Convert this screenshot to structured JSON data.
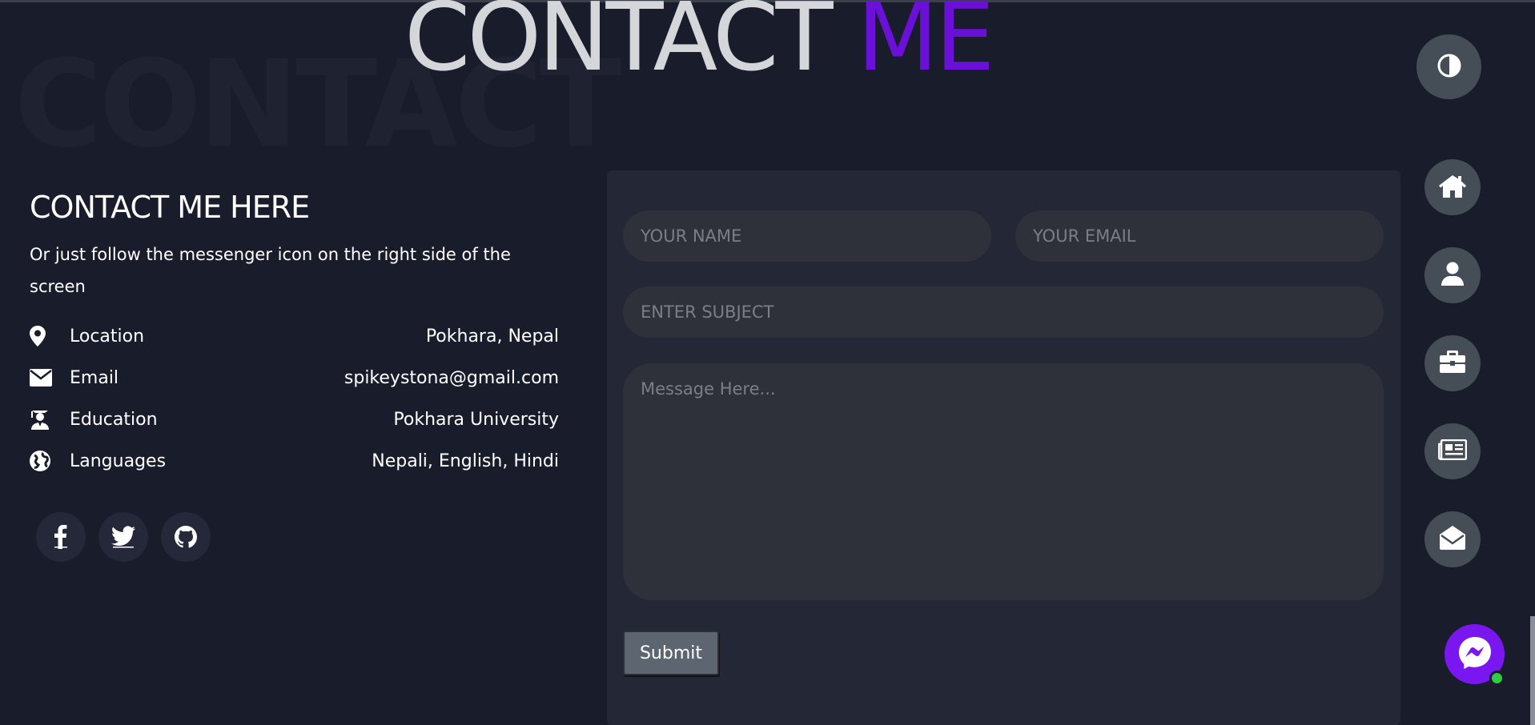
{
  "header": {
    "background_word": "CONTACT",
    "title_word_1": "CONTACT",
    "title_word_2": "ME"
  },
  "contact_info": {
    "title": "CONTACT ME HERE",
    "description": "Or just follow the messenger icon on the right side of the screen",
    "items": [
      {
        "icon": "map-marker-icon",
        "label": "Location",
        "value": "Pokhara, Nepal"
      },
      {
        "icon": "envelope-icon",
        "label": "Email",
        "value": "spikeystona@gmail.com"
      },
      {
        "icon": "graduate-icon",
        "label": "Education",
        "value": "Pokhara University"
      },
      {
        "icon": "globe-icon",
        "label": "Languages",
        "value": "Nepali, English, Hindi"
      }
    ],
    "socials": [
      "facebook-icon",
      "twitter-icon",
      "github-icon"
    ]
  },
  "form": {
    "name_placeholder": "YOUR NAME",
    "email_placeholder": "YOUR EMAIL",
    "subject_placeholder": "ENTER SUBJECT",
    "message_placeholder": "Message Here...",
    "submit_label": "Submit"
  },
  "nav_icons": [
    "home-icon",
    "user-icon",
    "briefcase-icon",
    "newspaper-icon",
    "envelope-open-icon"
  ],
  "colors": {
    "background": "#191d2b",
    "accent": "#6a10d8",
    "button_bg": "#454e56",
    "messenger": "#7a16f0",
    "online": "#31cc46"
  }
}
